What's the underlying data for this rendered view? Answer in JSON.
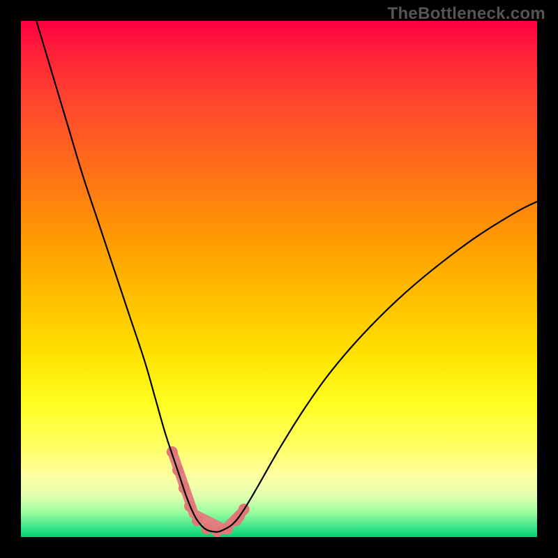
{
  "branding": "TheBottleneck.com",
  "chart_data": {
    "type": "line",
    "title": "",
    "xlabel": "",
    "ylabel": "",
    "xlim": [
      0,
      100
    ],
    "ylim": [
      0,
      100
    ],
    "grid": false,
    "legend": false,
    "series": [
      {
        "name": "bottleneck-curve",
        "color": "#000000",
        "x": [
          3,
          6,
          9,
          12,
          15,
          18,
          21,
          24,
          26,
          28,
          30,
          31,
          32,
          33,
          34,
          35,
          36,
          37,
          38,
          39,
          41,
          43,
          46,
          50,
          55,
          60,
          66,
          73,
          80,
          88,
          96,
          100
        ],
        "y": [
          100,
          90,
          80,
          70,
          61,
          52,
          43,
          34,
          27,
          20,
          14,
          11,
          8,
          5.5,
          3.5,
          2.2,
          1.4,
          1.1,
          1.0,
          1.3,
          2.5,
          5,
          10,
          17,
          25,
          32,
          39,
          46,
          52,
          58,
          63,
          65
        ]
      }
    ],
    "highlight": {
      "name": "optimal-range-markers",
      "color": "#e07878",
      "segments": [
        {
          "x": [
            29.5,
            33.5
          ],
          "y": [
            16,
            4.5
          ]
        },
        {
          "x": [
            33.5,
            39.5
          ],
          "y": [
            4.5,
            1.5
          ]
        },
        {
          "x": [
            39.5,
            43.0
          ],
          "y": [
            1.5,
            5.0
          ]
        }
      ],
      "dots": [
        {
          "x": 29.3,
          "y": 16.5
        },
        {
          "x": 30.4,
          "y": 13.0
        },
        {
          "x": 31.6,
          "y": 9.5
        },
        {
          "x": 32.7,
          "y": 6.0
        },
        {
          "x": 34.2,
          "y": 3.2
        },
        {
          "x": 36.0,
          "y": 1.6
        },
        {
          "x": 38.0,
          "y": 1.1
        },
        {
          "x": 40.0,
          "y": 1.6
        },
        {
          "x": 41.7,
          "y": 3.2
        },
        {
          "x": 42.3,
          "y": 4.0
        },
        {
          "x": 43.2,
          "y": 5.4
        }
      ]
    },
    "background": "vertical-gradient red→yellow→green (top=bad, bottom=good)"
  }
}
